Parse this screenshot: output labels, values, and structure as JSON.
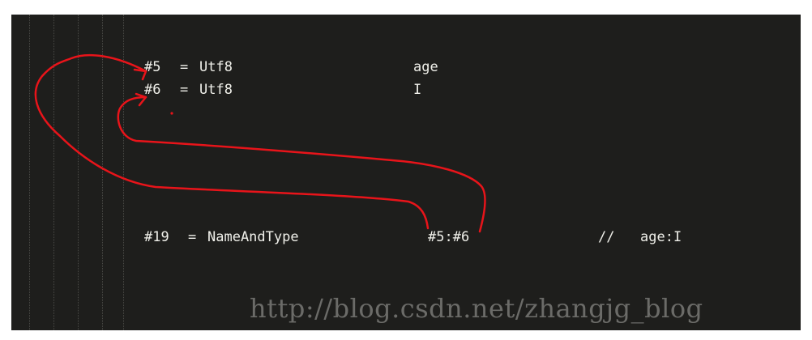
{
  "constant_pool": {
    "line1": {
      "index": "#5",
      "eq": "=",
      "type": "Utf8",
      "value": "age"
    },
    "line2": {
      "index": "#6",
      "eq": "=",
      "type": "Utf8",
      "value": "I"
    },
    "line3": {
      "index": "#19",
      "eq": "=",
      "type": "NameAndType",
      "refs": "#5:#6",
      "comment_mark": "//",
      "comment_text": "age:I"
    }
  },
  "watermark": {
    "text": "http://blog.csdn.net/zhangjg_blog"
  },
  "colors": {
    "editor_bg": "#1e1e1c",
    "text": "#f0f0ea",
    "annotation": "#e8141a",
    "watermark": "#6b6b68"
  }
}
